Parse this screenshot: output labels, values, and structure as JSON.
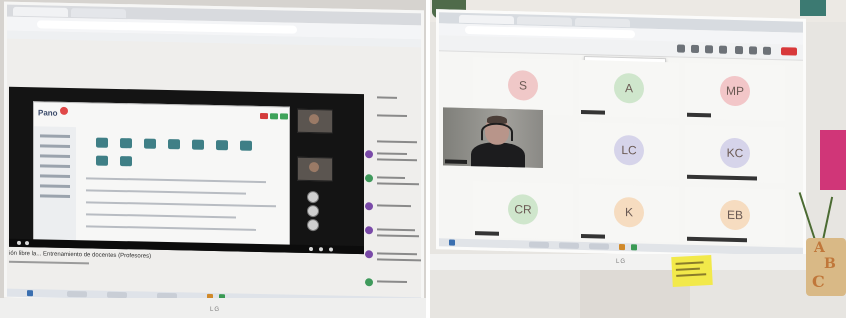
{
  "left_photo": {
    "caption": "ión libre la... Entrenamiento de docentes (Profesores)",
    "footer_brand": "LG"
  },
  "right_photo": {
    "participants": [
      {
        "initials": "S",
        "color": "#f0c8c8"
      },
      {
        "initials": "A",
        "color": "#cfe6cc"
      },
      {
        "initials": "MP",
        "color": "#f2c6c8"
      },
      {
        "initials": "LC",
        "color": "#d6d4ea"
      },
      {
        "initials": "KC",
        "color": "#d6d4ea"
      },
      {
        "initials": "CR",
        "color": "#cfe6cc"
      },
      {
        "initials": "K",
        "color": "#f6dcc0"
      },
      {
        "initials": "EB",
        "color": "#f6dcc0"
      }
    ],
    "footer_brand": "LG",
    "abc_letters": [
      "A",
      "B",
      "C"
    ]
  }
}
